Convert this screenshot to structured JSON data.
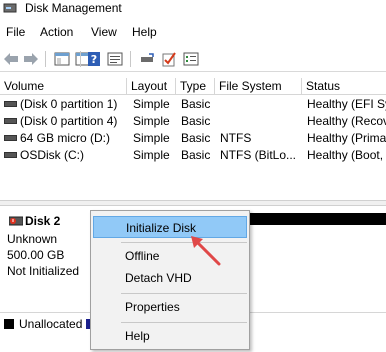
{
  "window": {
    "title": "Disk Management",
    "icon": "disk-management-icon"
  },
  "menu": [
    "File",
    "Action",
    "View",
    "Help"
  ],
  "toolbar": {
    "buttons": [
      "back-icon",
      "forward-icon",
      "console-tree-icon",
      "help-icon",
      "properties-icon",
      "connect-icon",
      "check-icon",
      "rescan-icon"
    ]
  },
  "volume_list": {
    "columns": [
      "Volume",
      "Layout",
      "Type",
      "File System",
      "Status"
    ],
    "rows": [
      {
        "volume": "(Disk 0 partition 1)",
        "layout": "Simple",
        "type": "Basic",
        "fs": "",
        "status": "Healthy (EFI Sys"
      },
      {
        "volume": "(Disk 0 partition 4)",
        "layout": "Simple",
        "type": "Basic",
        "fs": "",
        "status": "Healthy (Recov"
      },
      {
        "volume": "64 GB micro (D:)",
        "layout": "Simple",
        "type": "Basic",
        "fs": "NTFS",
        "status": "Healthy (Prima"
      },
      {
        "volume": "OSDisk (C:)",
        "layout": "Simple",
        "type": "Basic",
        "fs": "NTFS (BitLo...",
        "status": "Healthy (Boot,"
      }
    ]
  },
  "disk": {
    "name": "Disk 2",
    "kind": "Unknown",
    "size": "500.00 GB",
    "state": "Not Initialized"
  },
  "legend": {
    "unallocated": "Unallocated"
  },
  "context_menu": {
    "items": [
      "Initialize Disk",
      "Offline",
      "Detach VHD",
      "Properties",
      "Help"
    ],
    "selected": "Initialize Disk"
  },
  "colors": {
    "selection": "#91c9f7",
    "arrow": "#e04848",
    "unallocated": "#000000"
  }
}
